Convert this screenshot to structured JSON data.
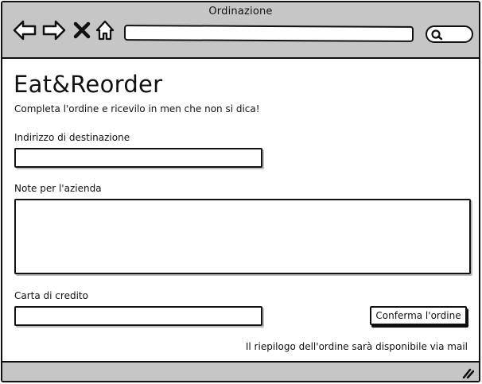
{
  "window": {
    "title": "Ordinazione"
  },
  "toolbar": {
    "icons": [
      "back-arrow-icon",
      "forward-arrow-icon",
      "close-x-icon",
      "home-icon",
      "search-icon"
    ],
    "url_value": "",
    "search_value": ""
  },
  "page": {
    "title": "Eat&Reorder",
    "tagline": "Completa l'ordine e ricevilo in men che non si dica!"
  },
  "form": {
    "address_label": "Indirizzo di destinazione",
    "address_value": "",
    "notes_label": "Note per l'azienda",
    "notes_value": "",
    "card_label": "Carta di credito",
    "card_value": "",
    "confirm_label": "Conferma l'ordine",
    "summary_note": "Il riepilogo dell'ordine sarà disponibile via mail"
  },
  "colors": {
    "chrome": "#c6c6c6",
    "ink": "#111111",
    "background": "#ffffff"
  }
}
